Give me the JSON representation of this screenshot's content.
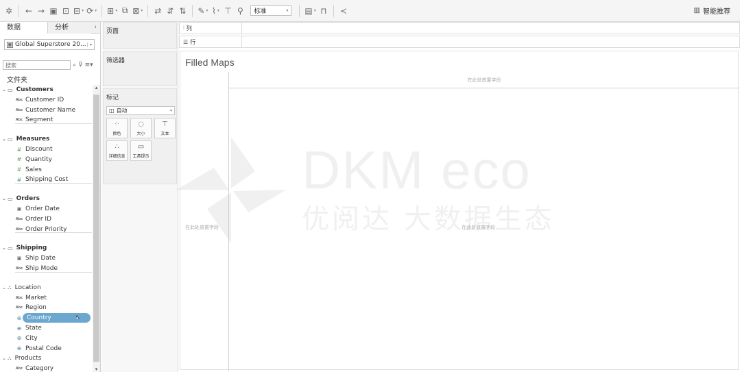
{
  "toolbar": {
    "mark_type_select": "标准",
    "smart_recommend": "智能推荐"
  },
  "left_pane": {
    "tab_data": "数据",
    "tab_analysis": "分析",
    "datasource": "Global Superstore 20...",
    "search_placeholder": "搜索",
    "folders_label": "文件夹",
    "groups": [
      {
        "name": "Customers",
        "fields": [
          {
            "type": "abc",
            "name": "Customer ID"
          },
          {
            "type": "abc",
            "name": "Customer Name"
          },
          {
            "type": "abc",
            "name": "Segment"
          }
        ]
      },
      {
        "name": "Measures",
        "fields": [
          {
            "type": "num",
            "name": "Discount"
          },
          {
            "type": "num",
            "name": "Quantity"
          },
          {
            "type": "num",
            "name": "Sales"
          },
          {
            "type": "num",
            "name": "Shipping Cost"
          }
        ]
      },
      {
        "name": "Orders",
        "fields": [
          {
            "type": "date",
            "name": "Order Date"
          },
          {
            "type": "abc",
            "name": "Order ID"
          },
          {
            "type": "abc",
            "name": "Order Priority"
          }
        ]
      },
      {
        "name": "Shipping",
        "fields": [
          {
            "type": "date",
            "name": "Ship Date"
          },
          {
            "type": "abc",
            "name": "Ship Mode"
          }
        ]
      },
      {
        "name": "Location",
        "fields": [
          {
            "type": "abc",
            "name": "Market"
          },
          {
            "type": "abc",
            "name": "Region"
          },
          {
            "type": "geo",
            "name": "Country",
            "selected": true
          },
          {
            "type": "geo",
            "name": "State"
          },
          {
            "type": "geo",
            "name": "City"
          },
          {
            "type": "geo",
            "name": "Postal Code"
          }
        ]
      },
      {
        "name": "Products",
        "fields": [
          {
            "type": "abc",
            "name": "Category"
          }
        ]
      }
    ]
  },
  "shelves": {
    "pages": "页面",
    "filters": "筛选器",
    "marks": "标记",
    "marks_type": "自动",
    "mark_buttons": [
      "颜色",
      "大小",
      "文本",
      "详细信息",
      "工具提示"
    ],
    "columns": "列",
    "rows": "行"
  },
  "sheet": {
    "title": "Filled Maps",
    "drop_field_top": "在此处放置字段",
    "drop_field_left": "在此处放置字段",
    "drop_field_center": "在此处放置字段"
  },
  "watermark": {
    "brand": "DKM eco",
    "slogan": "优阅达 大数据生态"
  }
}
